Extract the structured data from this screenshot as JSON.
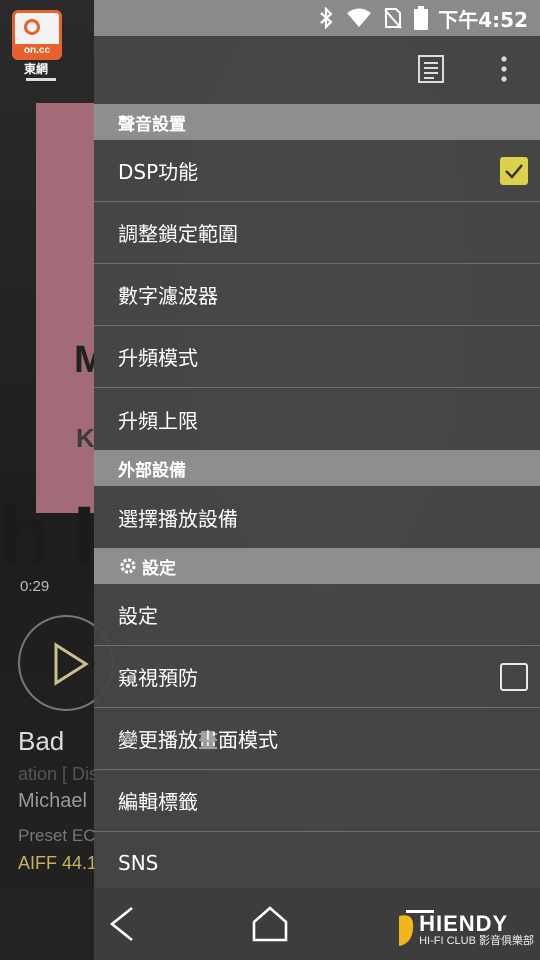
{
  "status_bar": {
    "time": "下午4:52",
    "icons": [
      "bluetooth-icon",
      "wifi-icon",
      "no-sim-icon",
      "battery-icon"
    ]
  },
  "background_player": {
    "logo_text": "on.cc",
    "logo_sub": "東網",
    "album_title": "M J",
    "album_sub": "K",
    "big_letters": "h KS OF",
    "elapsed_time": "0:29",
    "song_title": "Bad",
    "album_line": "ation [ Dis",
    "artist": "Michael",
    "preset": "Preset EC",
    "format": "AIFF 44.1"
  },
  "drawer": {
    "toolbar_icons": [
      "document-icon",
      "more-vert-icon"
    ],
    "sections": [
      {
        "header": "聲音設置",
        "items": [
          {
            "label": "DSP功能",
            "checkbox": true
          },
          {
            "label": "調整鎖定範圍"
          },
          {
            "label": "數字濾波器"
          },
          {
            "label": "升頻模式"
          },
          {
            "label": "升頻上限"
          }
        ]
      },
      {
        "header": "外部設備",
        "items": [
          {
            "label": "選擇播放設備"
          }
        ]
      },
      {
        "header": "設定",
        "header_icon": "gear-icon",
        "items": [
          {
            "label": "設定"
          },
          {
            "label": "窺視預防",
            "checkbox": false
          },
          {
            "label": "變更播放畫面模式"
          },
          {
            "label": "編輯標籤"
          },
          {
            "label": "SNS"
          }
        ]
      }
    ]
  },
  "nav_bar": {
    "buttons": [
      "back-icon",
      "home-icon",
      "recents-icon"
    ]
  },
  "watermark": {
    "brand": "HIENDY",
    "sub": "HI-FI CLUB 影音俱樂部"
  },
  "colors": {
    "checkbox_accent": "#dcd24a",
    "section_header": "#8e8e8e",
    "logo_orange": "#e8612c"
  }
}
